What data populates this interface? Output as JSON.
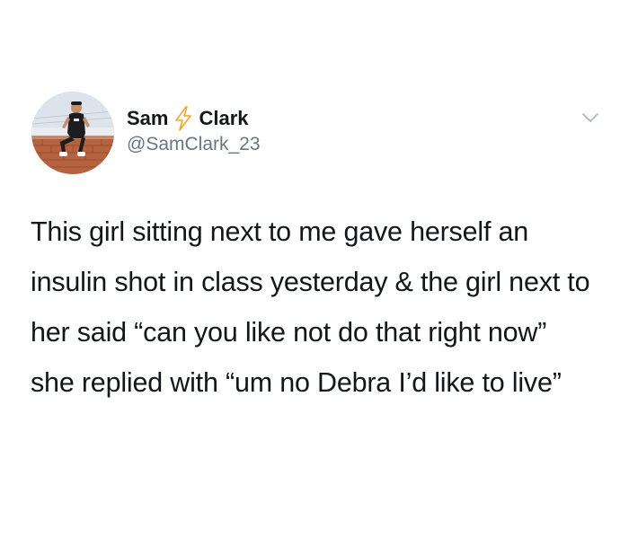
{
  "tweet": {
    "author": {
      "first_name": "Sam",
      "last_name": "Clark",
      "emoji_icon": "lightning-bolt-icon",
      "handle": "@SamClark_23"
    },
    "menu_icon": "chevron-down-icon",
    "text": "This girl sitting next to me gave herself an insulin shot in class yesterday & the girl next to her said “can you like not do that right now” she replied with “um no Debra I’d like to live”"
  },
  "colors": {
    "primary_text": "#14171a",
    "secondary_text": "#657786",
    "bolt_outline": "#f5a623",
    "chevron": "#aab8c2",
    "background": "#ffffff"
  }
}
